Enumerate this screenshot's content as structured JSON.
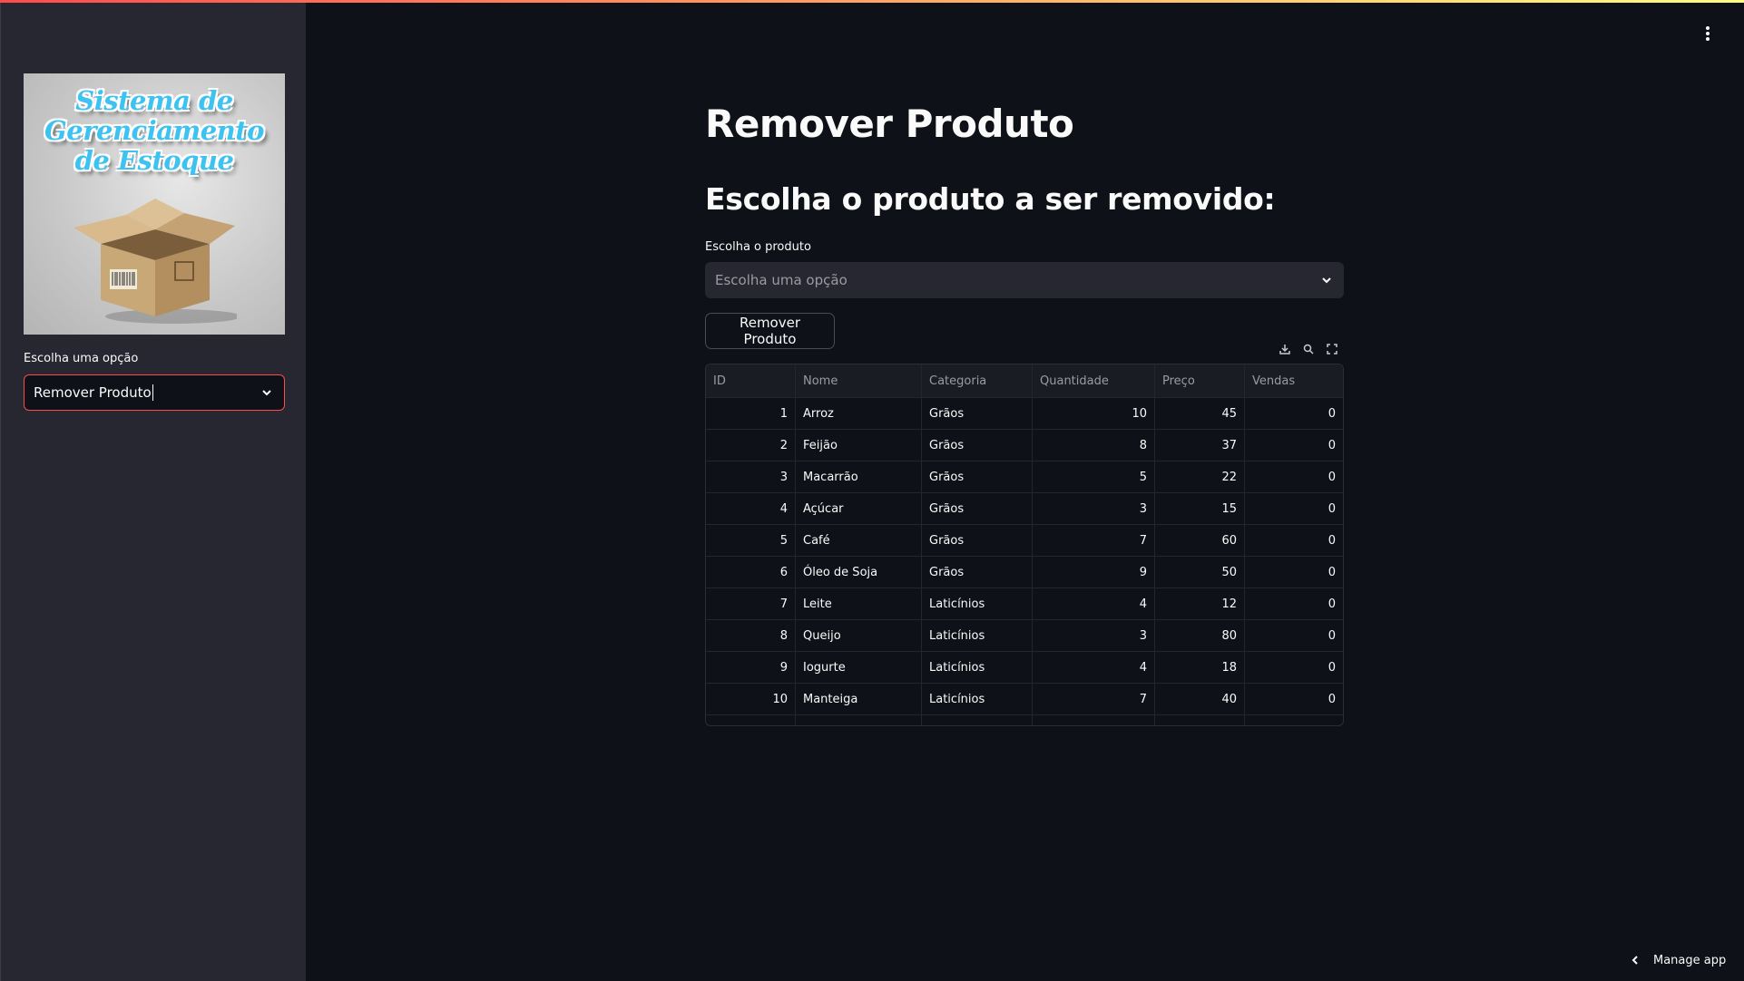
{
  "sidebar": {
    "logo_text": "Sistema de Gerenciamento de Estoque",
    "logo_lines": [
      "Sistema de",
      "Gerenciamento",
      "de Estoque"
    ],
    "select_label": "Escolha uma opção",
    "select_value": "Remover Produto"
  },
  "main": {
    "title": "Remover Produto",
    "subheader": "Escolha o produto a ser removido:",
    "product_label": "Escolha o produto",
    "product_placeholder": "Escolha uma opção",
    "remove_button": "Remover Produto"
  },
  "table": {
    "columns": [
      "ID",
      "Nome",
      "Categoria",
      "Quantidade",
      "Preço",
      "Vendas"
    ],
    "rows": [
      [
        "1",
        "Arroz",
        "Grãos",
        "10",
        "45",
        "0"
      ],
      [
        "2",
        "Feijão",
        "Grãos",
        "8",
        "37",
        "0"
      ],
      [
        "3",
        "Macarrão",
        "Grãos",
        "5",
        "22",
        "0"
      ],
      [
        "4",
        "Açúcar",
        "Grãos",
        "3",
        "15",
        "0"
      ],
      [
        "5",
        "Café",
        "Grãos",
        "7",
        "60",
        "0"
      ],
      [
        "6",
        "Óleo de Soja",
        "Grãos",
        "9",
        "50",
        "0"
      ],
      [
        "7",
        "Leite",
        "Laticínios",
        "4",
        "12",
        "0"
      ],
      [
        "8",
        "Queijo",
        "Laticínios",
        "3",
        "80",
        "0"
      ],
      [
        "9",
        "Iogurte",
        "Laticínios",
        "4",
        "18",
        "0"
      ],
      [
        "10",
        "Manteiga",
        "Laticínios",
        "7",
        "40",
        "0"
      ]
    ],
    "toolbar_icons": [
      "download-icon",
      "search-icon",
      "fullscreen-icon"
    ]
  },
  "footer": {
    "manage_label": "Manage app"
  },
  "colors": {
    "background": "#0e1117",
    "sidebar": "#262730",
    "accent": "#ff4b4b",
    "text": "#fafafa"
  }
}
